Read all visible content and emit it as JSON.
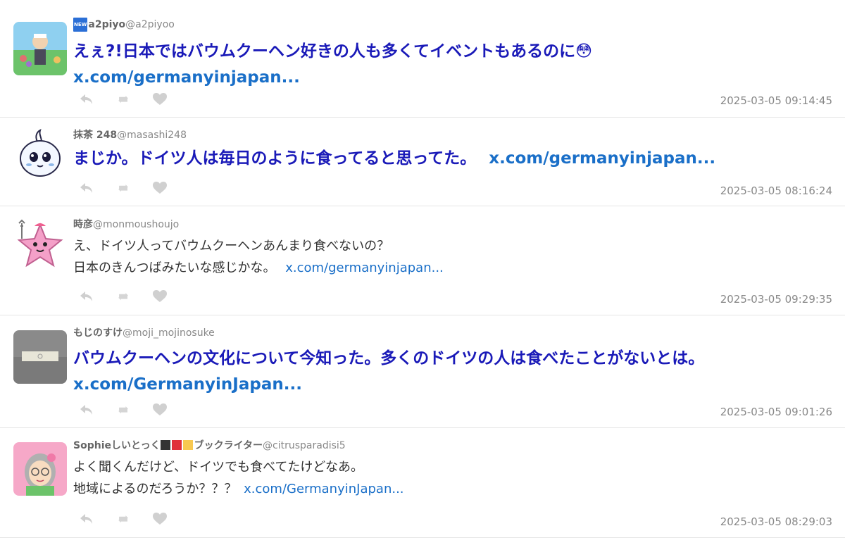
{
  "tweets": [
    {
      "badge": "NEW",
      "display_name": "a2piyo",
      "handle": "@a2piyoo",
      "text_lines": [
        "えぇ?!日本ではバウムクーヘン好きの人も多くてイベントもあるのに😳"
      ],
      "link": "x.com/germanyinjapan...",
      "timestamp": "2025-03-05 09:14:45"
    },
    {
      "display_name": "抹茶 248",
      "handle": "@masashi248",
      "text_lines": [
        "まじか。ドイツ人は毎日のように食ってると思ってた。"
      ],
      "link": "x.com/germanyinjapan...",
      "timestamp": "2025-03-05 08:16:24"
    },
    {
      "display_name": "時彦",
      "handle": "@monmoushoujo",
      "text_lines": [
        "え、ドイツ人ってバウムクーヘンあんまり食べないの？",
        "日本のきんつばみたいな感じかな。"
      ],
      "link": "x.com/germanyinjapan...",
      "timestamp": "2025-03-05 09:29:35"
    },
    {
      "display_name": "もじのすけ",
      "handle": "@moji_mojinosuke",
      "text_lines": [
        "バウムクーヘンの文化について今知った。多くのドイツの人は食べたことがないとは。"
      ],
      "link": "x.com/GermanyinJapan...",
      "timestamp": "2025-03-05 09:01:26"
    },
    {
      "display_name_prefix": "Sophie",
      "display_name_suffix": "しいとっく",
      "display_name_tail": "ブックライター",
      "handle": "@citrusparadisi5",
      "text_lines": [
        "よく聞くんだけど、ドイツでも食べてたけどなあ。",
        "地域によるのだろうか？？？"
      ],
      "link": "x.com/GermanyinJapan...",
      "timestamp": "2025-03-05 08:29:03"
    }
  ],
  "colors": {
    "link": "#1a6fc8",
    "emphasis_text": "#1a1ab8",
    "icon": "#c8c8c8",
    "timestamp": "#888888"
  },
  "icons": [
    "reply-icon",
    "retweet-icon",
    "like-icon"
  ]
}
